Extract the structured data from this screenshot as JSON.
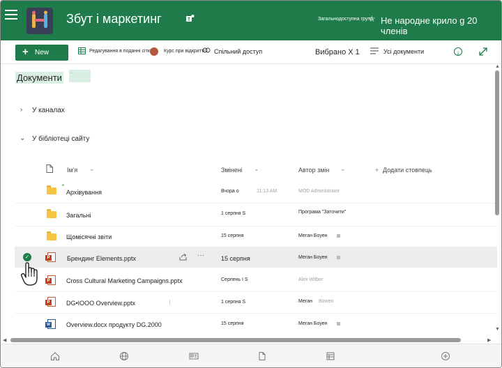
{
  "header": {
    "site_title": "Збут і маркетинг",
    "privacy": "Загальнодоступна група",
    "members": "Не народне крило g 20 членів",
    "accent": "#1f7c4a"
  },
  "commandbar": {
    "new_label": "New",
    "edit_grid": "Редагування в поданні сітки",
    "course": "Курс при відкритті",
    "share": "Спільний доступ",
    "selected": "Вибрано X 1",
    "all_docs": "Усі документи"
  },
  "content": {
    "doc_title": "Документи",
    "doc_badge": "...",
    "group_channels": "У каналах",
    "group_site": "У бібліотеці сайту"
  },
  "columns": {
    "name": "Ім'я",
    "modified": "Змінені",
    "modified_by": "Автор змін",
    "add_column": "Додати стовпець"
  },
  "rows": [
    {
      "type": "folder",
      "name": "Архівування",
      "modified": "Вчора о",
      "time": "11:13 AM",
      "author": "MOD Administrator"
    },
    {
      "type": "folder",
      "name": "Загальні",
      "modified": "1 серпня S",
      "author": "Програма \"Заточити\""
    },
    {
      "type": "folder",
      "name": "Щомісячні звіти",
      "modified": "15 серпня",
      "author": "Меган Боуен"
    },
    {
      "type": "ppt",
      "name": "Брендинг Elements.pptx",
      "modified": "15 серпня",
      "author": "Меган Боуен",
      "selected": true
    },
    {
      "type": "ppt",
      "name": "Cross Cultural Marketing Campaigns.pptx",
      "modified": "Серпень І S",
      "author": "Alex Wilber"
    },
    {
      "type": "ppt",
      "name": "DG•IOOO Overview.pptx",
      "modified": "1 серпня S",
      "author": "Меган",
      "author2": "Bowen"
    },
    {
      "type": "word",
      "name": "Overview.docx продукту DG.2000",
      "modified": "15 серпня",
      "author": "Меган Боуен"
    }
  ]
}
